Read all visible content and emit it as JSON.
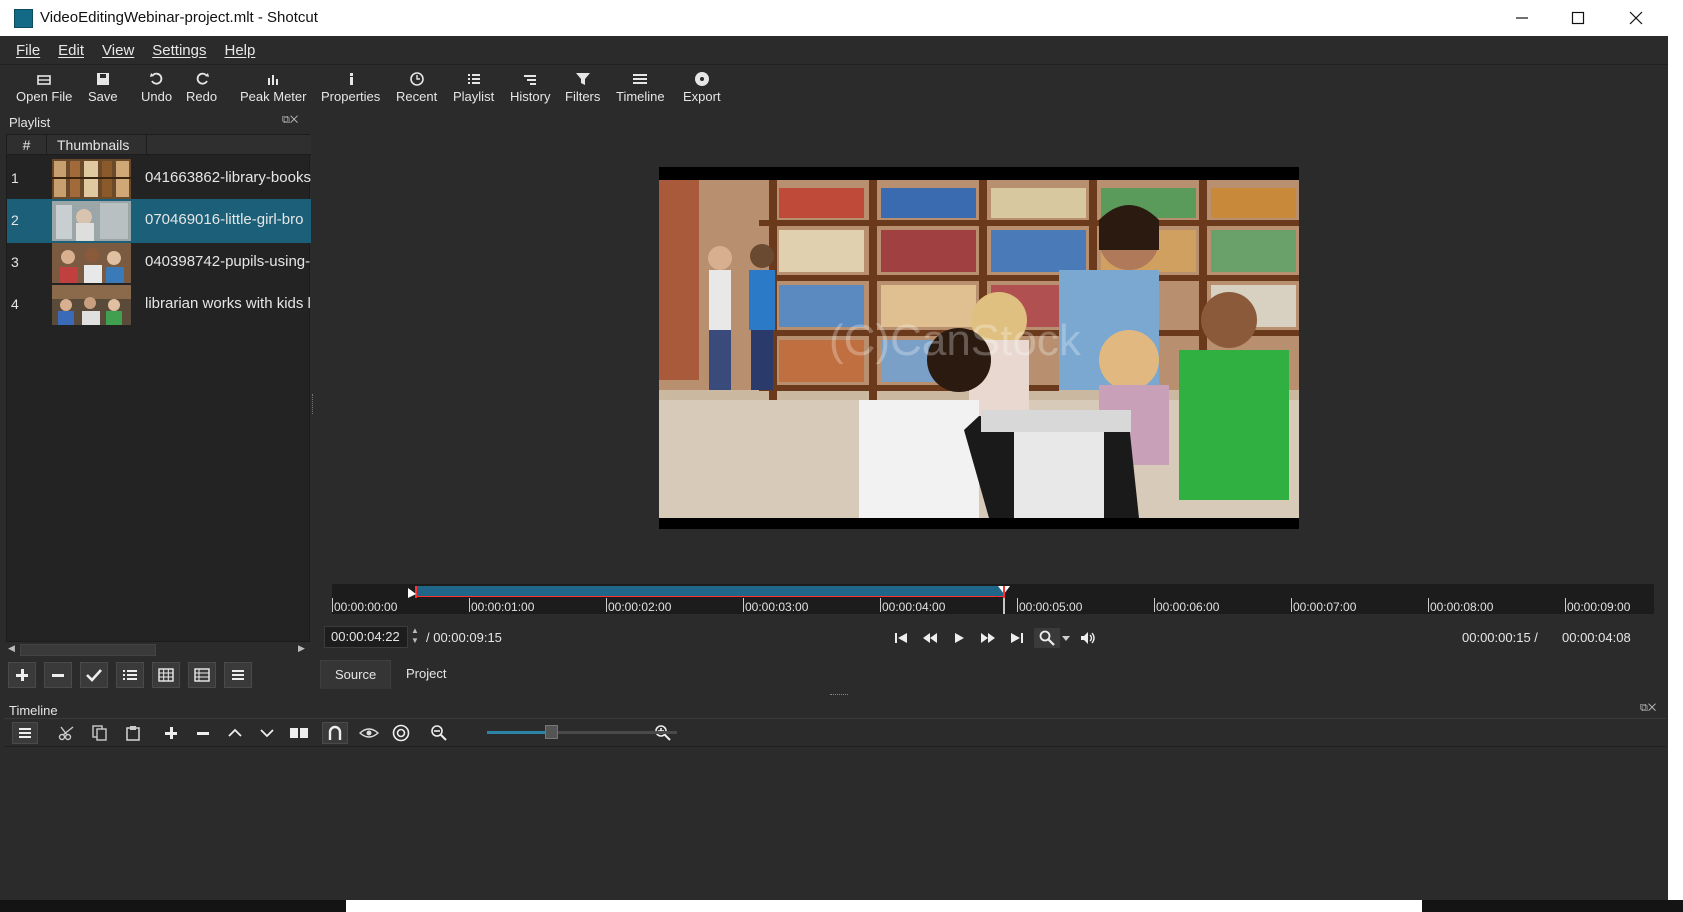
{
  "window": {
    "title": "VideoEditingWebinar-project.mlt - Shotcut",
    "min_glyph": "—",
    "max_glyph": "☐",
    "close_glyph": "✕"
  },
  "menu": [
    "File",
    "Edit",
    "View",
    "Settings",
    "Help"
  ],
  "toolbar": [
    {
      "label": "Open File",
      "icon": "open-file-icon"
    },
    {
      "label": "Save",
      "icon": "save-icon"
    },
    {
      "label": "Undo",
      "icon": "undo-icon"
    },
    {
      "label": "Redo",
      "icon": "redo-icon"
    },
    {
      "label": "Peak Meter",
      "icon": "peak-meter-icon"
    },
    {
      "label": "Properties",
      "icon": "info-icon"
    },
    {
      "label": "Recent",
      "icon": "clock-icon"
    },
    {
      "label": "Playlist",
      "icon": "list-icon"
    },
    {
      "label": "History",
      "icon": "history-icon"
    },
    {
      "label": "Filters",
      "icon": "filter-icon"
    },
    {
      "label": "Timeline",
      "icon": "timeline-icon"
    },
    {
      "label": "Export",
      "icon": "export-icon"
    }
  ],
  "playlist": {
    "title": "Playlist",
    "header_num": "#",
    "header_thumb": "Thumbnails",
    "items": [
      {
        "num": "1",
        "name": "041663862-library-books",
        "selected": false
      },
      {
        "num": "2",
        "name": "070469016-little-girl-bro",
        "selected": true
      },
      {
        "num": "3",
        "name": "040398742-pupils-using-",
        "selected": false
      },
      {
        "num": "4",
        "name": "librarian works with kids l",
        "selected": false
      }
    ]
  },
  "viewer": {
    "watermark": "(C)CanStock",
    "position": "00:00:04:22",
    "duration": "/ 00:00:09:15",
    "in_point": "00:00:00:15 /",
    "out_point": "00:00:04:08",
    "ticks": [
      "00:00:00:00",
      "00:00:01:00",
      "00:00:02:00",
      "00:00:03:00",
      "00:00:04:00",
      "00:00:05:00",
      "00:00:06:00",
      "00:00:07:00",
      "00:00:08:00",
      "00:00:09:00"
    ],
    "tabs": [
      "Source",
      "Project"
    ]
  },
  "timeline": {
    "title": "Timeline"
  },
  "colors": {
    "accent": "#1b5f78",
    "inout_bar": "#1f6688",
    "playhead": "#ff3030"
  }
}
